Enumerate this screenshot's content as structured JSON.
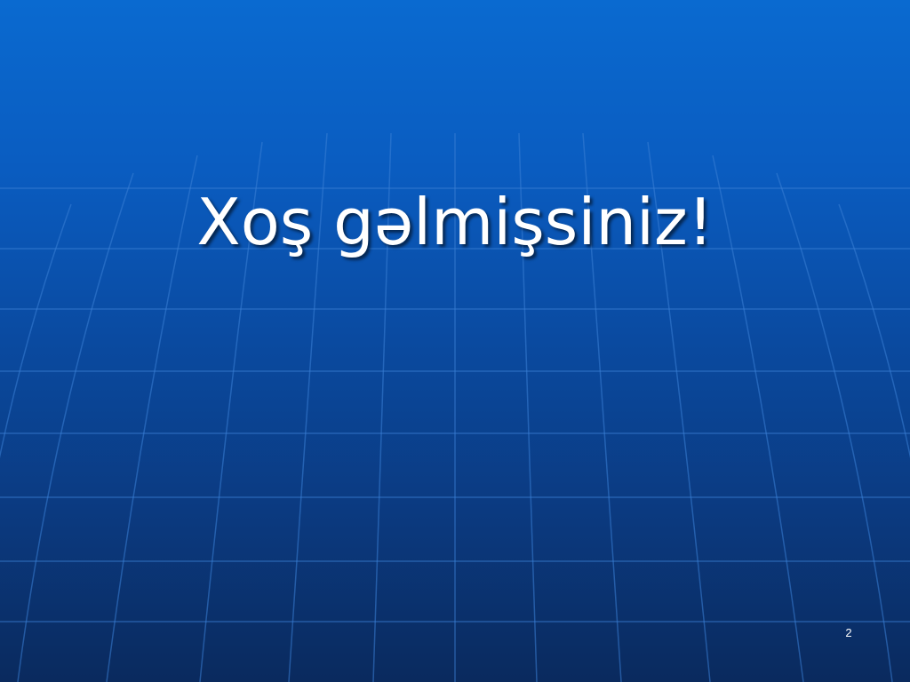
{
  "slide": {
    "title": "Xoş gəlmişsiniz!",
    "slide_number": "2"
  },
  "colors": {
    "background_top": "#0a6ad0",
    "background_bottom": "#0a2a5e",
    "grid_line": "#3a7fd6",
    "text": "#ffffff"
  }
}
